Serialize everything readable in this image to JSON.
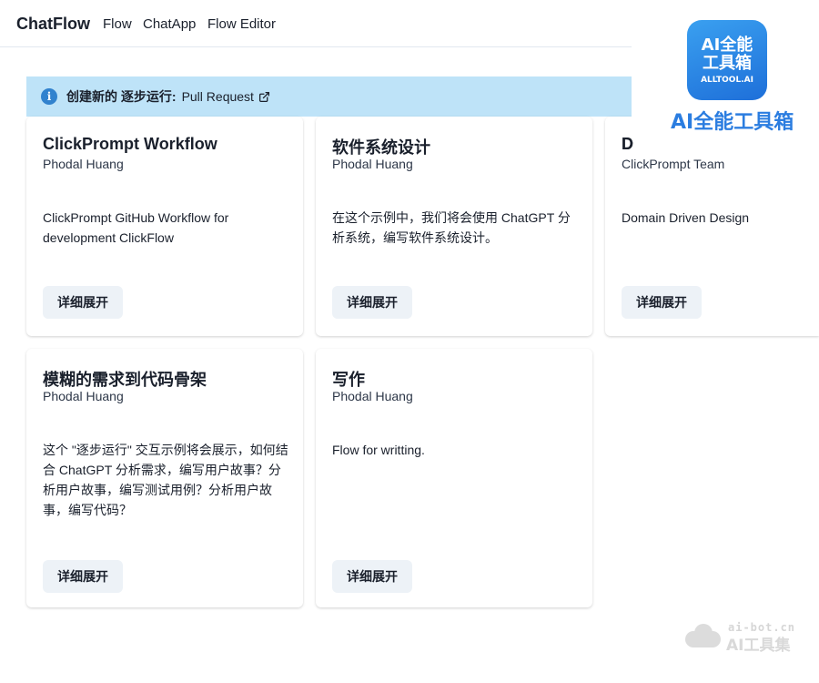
{
  "nav": {
    "brand": "ChatFlow",
    "links": [
      "Flow",
      "ChatApp",
      "Flow Editor"
    ]
  },
  "banner": {
    "icon": "info-icon",
    "title": "创建新的 逐步运行:",
    "link_label": "Pull Request"
  },
  "cards": [
    {
      "title": "ClickPrompt Workflow",
      "author": "Phodal Huang",
      "description": "ClickPrompt GitHub Workflow for development ClickFlow",
      "button": "详细展开"
    },
    {
      "title": "软件系统设计",
      "author": "Phodal Huang",
      "description": "在这个示例中，我们将会使用 ChatGPT 分析系统，编写软件系统设计。",
      "button": "详细展开"
    },
    {
      "title": "D",
      "author": "ClickPrompt Team",
      "description": "Domain Driven Design",
      "button": "详细展开"
    },
    {
      "title": "模糊的需求到代码骨架",
      "author": "Phodal Huang",
      "description": "这个 \"逐步运行\" 交互示例将会展示，如何结合 ChatGPT 分析需求，编写用户故事？分析用户故事，编写测试用例？分析用户故事，编写代码？",
      "button": "详细展开"
    },
    {
      "title": "写作",
      "author": "Phodal Huang",
      "description": "Flow for writting.",
      "button": "详细展开"
    }
  ],
  "logo": {
    "line1": "AI全能",
    "line2": "工具箱",
    "sub": "ALLTOOL.AI",
    "caption": "AI全能工具箱"
  },
  "watermark": {
    "domain": "ai-bot.cn",
    "name": "AI工具集"
  },
  "colors": {
    "banner_bg": "#bee3f8",
    "info_icon": "#3182ce",
    "button_bg": "#edf2f7",
    "logo_blue": "#2b7de0"
  }
}
